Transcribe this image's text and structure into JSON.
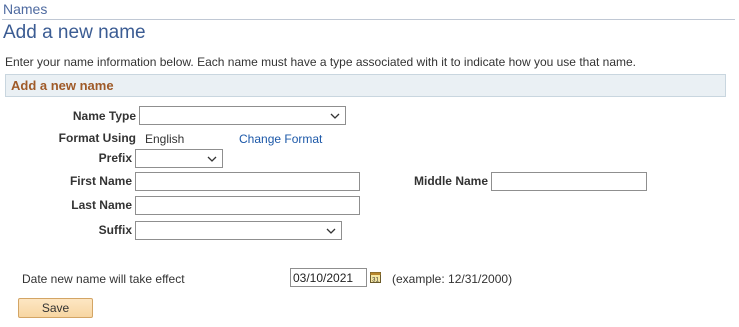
{
  "breadcrumb": "Names",
  "page_title": "Add a new name",
  "instructions": "Enter your name information below. Each name must have a type associated with it to indicate how you use that name.",
  "section_title": "Add a new name",
  "form": {
    "name_type_label": "Name Type",
    "name_type_value": "",
    "format_using_label": "Format Using",
    "format_using_value": "English",
    "change_format_link": "Change Format",
    "prefix_label": "Prefix",
    "prefix_value": "",
    "first_name_label": "First Name",
    "first_name_value": "",
    "middle_name_label": "Middle Name",
    "middle_name_value": "",
    "last_name_label": "Last Name",
    "last_name_value": "",
    "suffix_label": "Suffix",
    "suffix_value": "",
    "effective_date_label": "Date new name will take effect",
    "effective_date_value": "03/10/2021",
    "effective_date_example": "(example: 12/31/2000)",
    "calendar_icon_text": "31"
  },
  "save_label": "Save",
  "icons": {
    "dropdown": "chevron-down-icon",
    "calendar": "calendar-icon"
  },
  "colors": {
    "title": "#3b5c93",
    "section_title": "#9f5a28",
    "link": "#1c58a8",
    "button_bg": "#f7d6a2"
  }
}
